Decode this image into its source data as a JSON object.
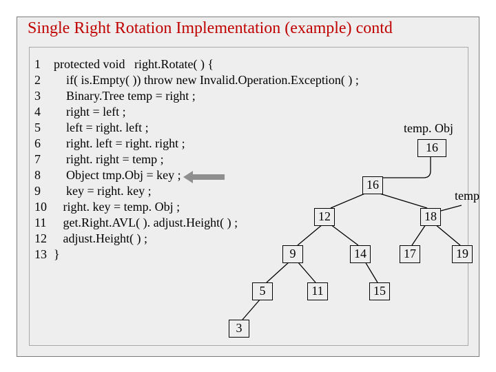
{
  "title": "Single Right Rotation Implementation (example) contd",
  "code": [
    {
      "n": "1",
      "t": "protected void   right.Rotate( ) {"
    },
    {
      "n": "2",
      "t": "    if( is.Empty( )) throw new Invalid.Operation.Exception( ) ;"
    },
    {
      "n": "3",
      "t": "    Binary.Tree temp = right ;"
    },
    {
      "n": "4",
      "t": "    right = left ;"
    },
    {
      "n": "5",
      "t": "    left = right. left ;"
    },
    {
      "n": "6",
      "t": "    right. left = right. right ;"
    },
    {
      "n": "7",
      "t": "    right. right = temp ;"
    },
    {
      "n": "8",
      "t": "    Object tmp.Obj = key ;"
    },
    {
      "n": "9",
      "t": "    key = right. key ;"
    },
    {
      "n": "10",
      "t": "   right. key = temp. Obj ;"
    },
    {
      "n": "11",
      "t": "   get.Right.AVL( ). adjust.Height( ) ;"
    },
    {
      "n": "12",
      "t": "   adjust.Height( ) ;"
    },
    {
      "n": "13",
      "t": "}"
    }
  ],
  "labels": {
    "tempObj": "temp. Obj",
    "temp": "temp"
  },
  "tempObjBox": "16",
  "tree": {
    "n16": "16",
    "n12": "12",
    "n18": "18",
    "n9": "9",
    "n14": "14",
    "n17": "17",
    "n19": "19",
    "n5": "5",
    "n11": "11",
    "n15": "15",
    "n3": "3"
  }
}
